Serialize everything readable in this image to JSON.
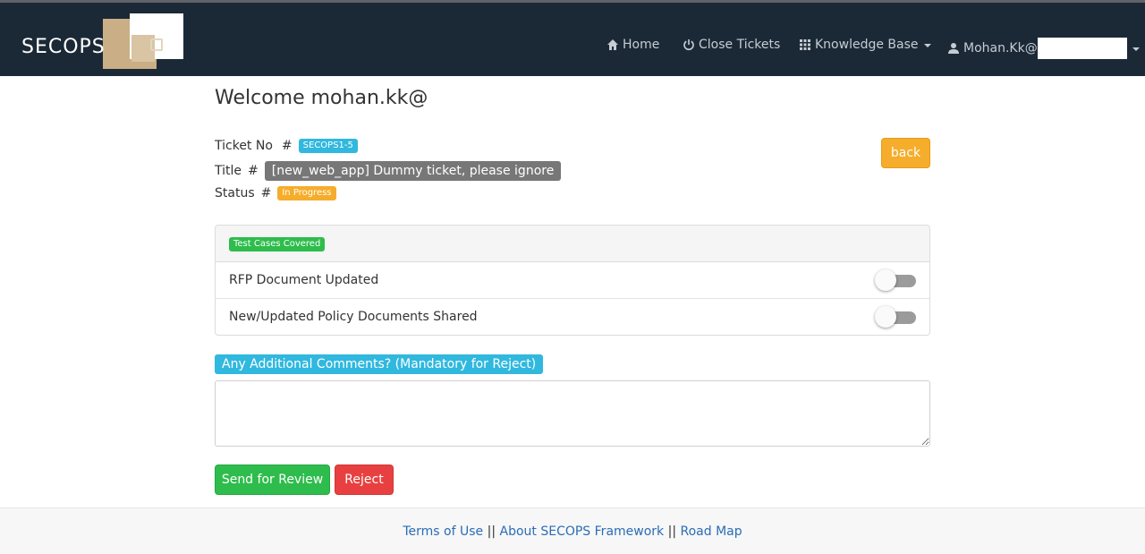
{
  "nav": {
    "logo_text": "SECOPS",
    "home": "Home",
    "close_tickets": "Close Tickets",
    "knowledge_base": "Knowledge Base",
    "user": "Mohan.Kk@"
  },
  "main": {
    "welcome": "Welcome mohan.kk@",
    "ticket_no_label": "Ticket No",
    "hash": "#",
    "ticket_no": "SECOPS1-5",
    "title_label": "Title",
    "title": "[new_web_app] Dummy ticket, please ignore",
    "status_label": "Status",
    "status": "In Progress",
    "back": "back",
    "checklist": {
      "header_badge": "Test Cases Covered",
      "items": [
        {
          "label": "RFP Document Updated",
          "checked": false
        },
        {
          "label": "New/Updated Policy Documents Shared",
          "checked": false
        }
      ]
    },
    "comments_label": "Any Additional Comments? (Mandatory for Reject)",
    "comments_value": "",
    "send_for_review": "Send for Review",
    "reject": "Reject"
  },
  "footer": {
    "terms": "Terms of Use",
    "sep": "||",
    "about": "About SECOPS Framework",
    "roadmap": "Road Map"
  },
  "colors": {
    "navbar": "#1b2937",
    "info_badge": "#31b8de",
    "grey_badge": "#777777",
    "warning": "#f6ad2b",
    "success": "#2ebd4c",
    "danger": "#e84040",
    "link": "#2a6db5"
  }
}
